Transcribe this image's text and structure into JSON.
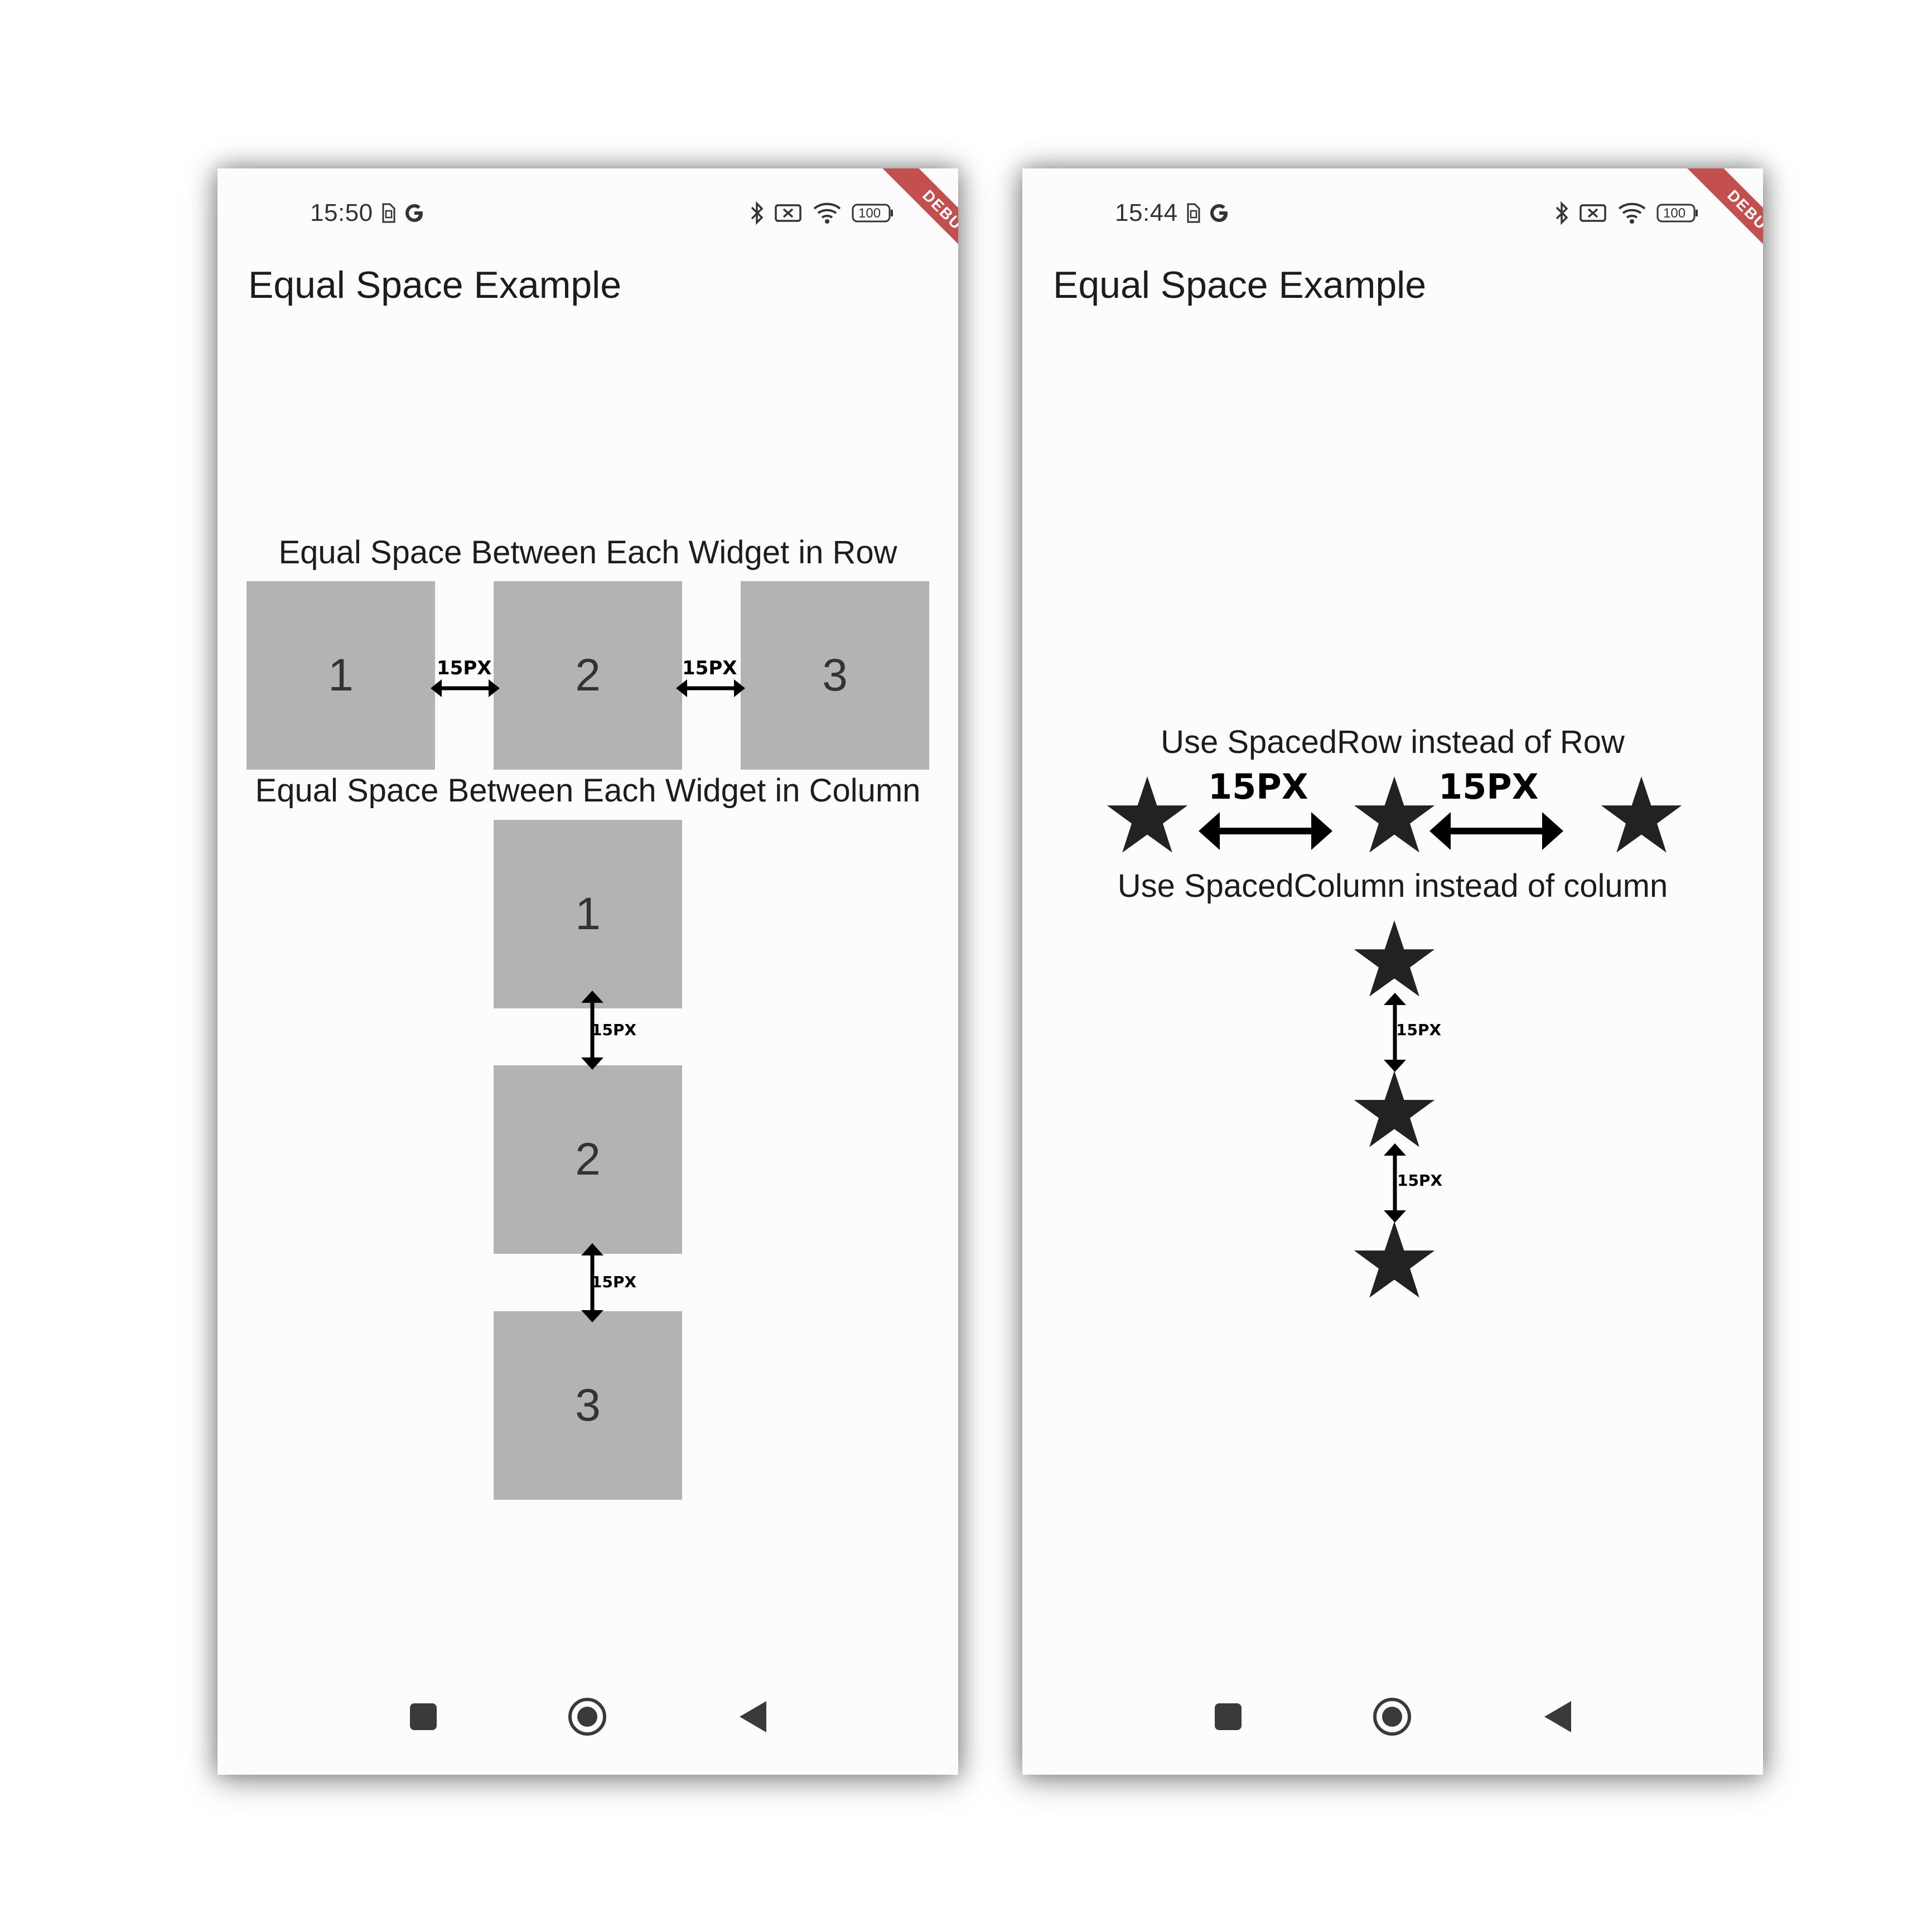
{
  "screens": [
    {
      "status": {
        "time": "15:50"
      },
      "debug_label": "DEBUG",
      "battery": "100",
      "title": "Equal Space Example",
      "row_caption": "Equal Space Between Each Widget in Row",
      "row_boxes": [
        "1",
        "2",
        "3"
      ],
      "column_caption": "Equal Space Between Each Widget in Column",
      "column_boxes": [
        "1",
        "2",
        "3"
      ],
      "gap_label": "15PX"
    },
    {
      "status": {
        "time": "15:44"
      },
      "debug_label": "DEBUG",
      "battery": "100",
      "title": "Equal Space Example",
      "row_caption": "Use SpacedRow instead of Row",
      "column_caption": "Use SpacedColumn instead of column",
      "gap_label": "15PX"
    }
  ],
  "icons": {
    "status_left": [
      "sim-icon",
      "google-g-icon"
    ],
    "status_right": [
      "bluetooth-icon",
      "mobile-data-off-icon",
      "wifi-icon",
      "battery-icon"
    ],
    "nav": [
      "recents-square-icon",
      "home-circle-icon",
      "back-triangle-icon"
    ],
    "content": "star-icon"
  },
  "colors": {
    "box": "#b3b3b3",
    "background": "#fdfcfd",
    "debug_banner": "#b21e1e",
    "text": "#1d1b20"
  }
}
